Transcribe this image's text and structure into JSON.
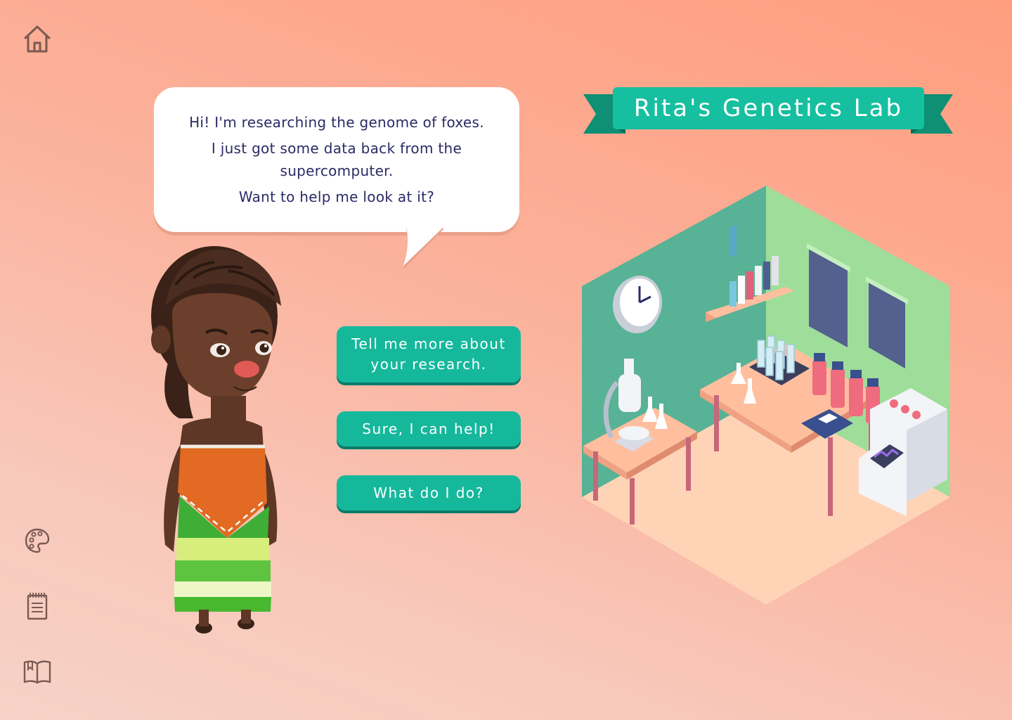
{
  "sidebar": {
    "home_icon": "home-icon",
    "bottom_icons": [
      "palette-icon",
      "notepad-icon",
      "book-icon"
    ]
  },
  "dialogue": {
    "lines": [
      "Hi! I'm researching the genome of foxes.",
      "I just got some data back from the supercomputer.",
      "Want to help me look at it?"
    ]
  },
  "choices": [
    "Tell me more about your research.",
    "Sure, I can help!",
    "What do I do?"
  ],
  "lab": {
    "title": "Rita's Genetics Lab"
  },
  "colors": {
    "accent": "#16b89c",
    "accent_shadow": "#0c7c69",
    "dialogue_text": "#2c2a66",
    "icon": "#7a5a52"
  }
}
